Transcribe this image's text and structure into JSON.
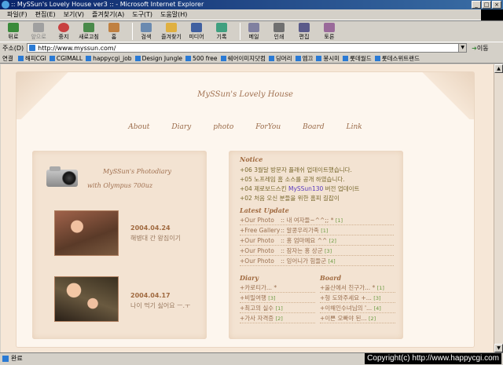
{
  "window": {
    "title": ":: MySSun's Lovely House ver3 :: - Microsoft Internet Explorer"
  },
  "menu": [
    "파일(F)",
    "편집(E)",
    "보기(V)",
    "즐겨찾기(A)",
    "도구(T)",
    "도움말(H)"
  ],
  "toolbar": [
    {
      "label": "뒤로",
      "icon": "back-arrow-icon"
    },
    {
      "label": "앞으로",
      "icon": "forward-arrow-icon"
    },
    {
      "label": "중지",
      "icon": "stop-icon"
    },
    {
      "label": "새로고침",
      "icon": "refresh-icon"
    },
    {
      "label": "홈",
      "icon": "home-icon"
    },
    {
      "label": "검색",
      "icon": "search-icon"
    },
    {
      "label": "즐겨찾기",
      "icon": "favorites-icon"
    },
    {
      "label": "미디어",
      "icon": "media-icon"
    },
    {
      "label": "기록",
      "icon": "history-icon"
    },
    {
      "label": "메일",
      "icon": "mail-icon"
    },
    {
      "label": "인쇄",
      "icon": "print-icon"
    },
    {
      "label": "편집",
      "icon": "edit-icon"
    },
    {
      "label": "토론",
      "icon": "discuss-icon"
    }
  ],
  "address": {
    "label": "주소(D)",
    "url": "http://www.myssun.com/",
    "go": "이동"
  },
  "links": {
    "label": "연결",
    "items": [
      "해피CGI",
      "CGIMALL",
      "happycgi_job",
      "Design Jungle",
      "500 free",
      "쉐어이미지닷컴",
      "딩머리",
      "엠끄",
      "봉시미",
      "롯데월드",
      "롯데스위트랜드"
    ]
  },
  "site": {
    "title": "MySSun's Lovely House",
    "nav": [
      "About",
      "Diary",
      "photo",
      "ForYou",
      "Board",
      "Link"
    ]
  },
  "photodiary": {
    "title": "MySSun's Photodiary",
    "subtitle": "with Olympus 700uz",
    "entries": [
      {
        "date": "2004.04.24",
        "caption": "해병대 간 왕짐이기"
      },
      {
        "date": "2004.04.17",
        "caption": "나이 먹기 싫어요 ㅡ.ㅜ"
      }
    ]
  },
  "notice": {
    "title": "Notice",
    "items": [
      {
        "text": "+06 3월달 방문자 플래쉬 업데이트했습니다."
      },
      {
        "text": "+05 노프레임 홈 소스를 공개 하였습니다."
      },
      {
        "pre": "+04 제로보드스킨 ",
        "hl": "MySSun130",
        "post": " 버전 업데이트"
      },
      {
        "text": "+02 처음 오신 분들을 위한 홈피 길잡이"
      }
    ]
  },
  "latest": {
    "title": "Latest Update",
    "items": [
      {
        "cat": "+Our Photo",
        "text": ":: 내 여자들~^^;; *",
        "count": "[1]"
      },
      {
        "cat": "+Free Gallery",
        "text": ":: 알콩우리가족",
        "count": "[1]"
      },
      {
        "cat": "+Our Photo",
        "text": ":: 홍 엄마예요 ^^",
        "count": "[2]"
      },
      {
        "cat": "+Our Photo",
        "text": ":: 잠자는 홍 상군",
        "count": "[3]"
      },
      {
        "cat": "+Our Photo",
        "text": ":: 잉어니가 힘들군",
        "count": "[4]"
      }
    ]
  },
  "diary": {
    "title": "Diary",
    "items": [
      {
        "text": "+카로티가... *",
        "count": ""
      },
      {
        "text": "+비밀여행",
        "count": "[3]"
      },
      {
        "text": "+최고의 실수",
        "count": "[1]"
      },
      {
        "text": "+가사 자격증",
        "count": "[2]"
      }
    ]
  },
  "board": {
    "title": "Board",
    "items": [
      {
        "text": "+울산에서 친구가... *",
        "count": "[1]"
      },
      {
        "text": "+형 도와주세요 +...",
        "count": "[3]"
      },
      {
        "text": "+이해인수녀님의 '...",
        "count": "[4]"
      },
      {
        "text": "+이쁜 오빠야 된...",
        "count": "[2]"
      }
    ]
  },
  "status": {
    "text": "완료"
  },
  "watermark": "Copyright(c) http://www.happycgi.com"
}
